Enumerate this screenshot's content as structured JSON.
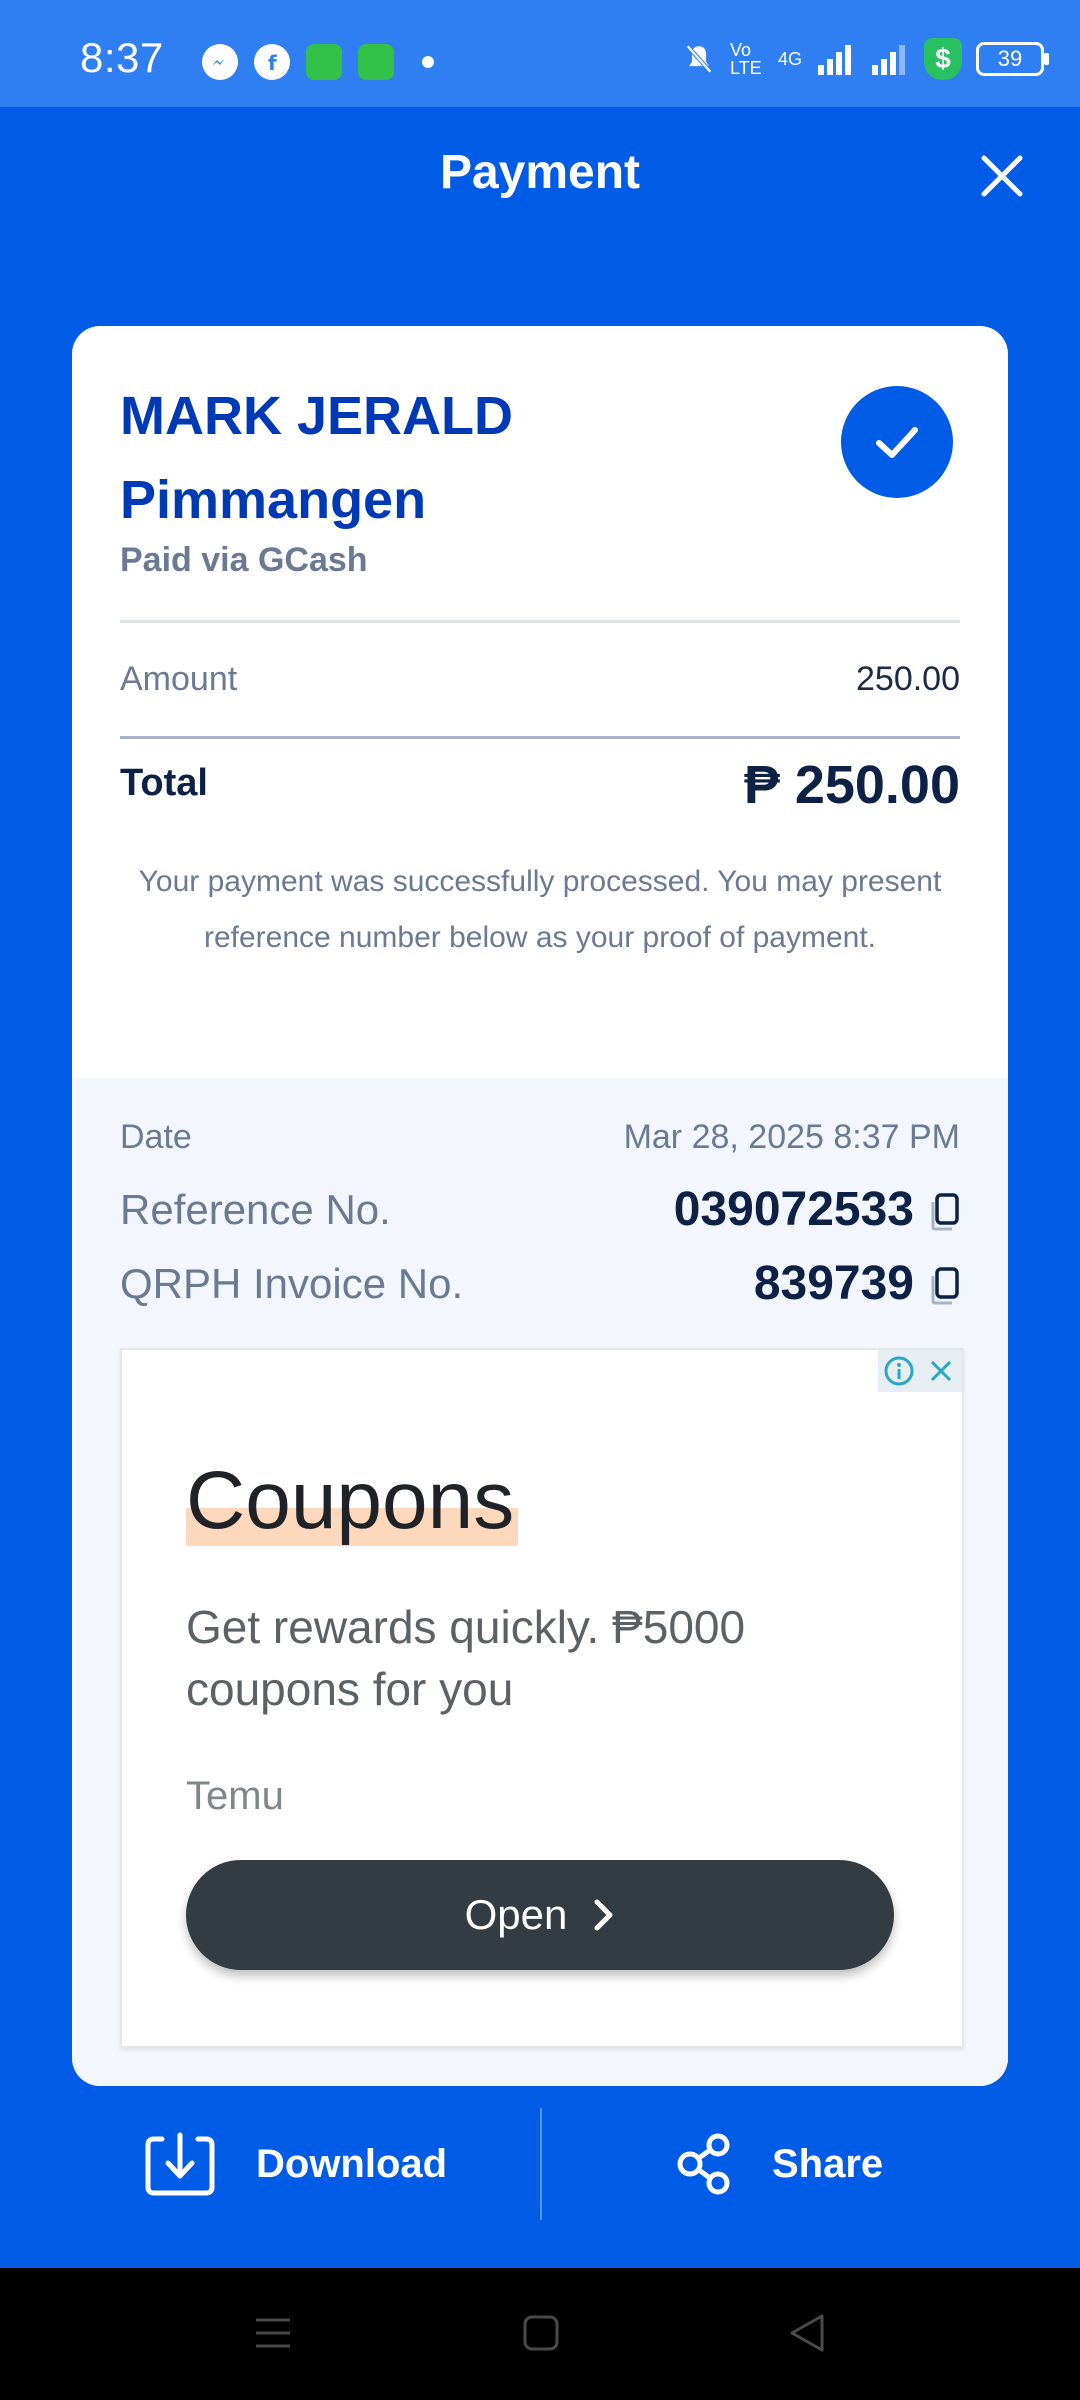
{
  "status_bar": {
    "time": "8:37",
    "battery": "39",
    "network": "4G",
    "volte": "Vo LTE"
  },
  "header": {
    "title": "Payment"
  },
  "receipt": {
    "name_line1": "MARK JERALD",
    "name_line2": "Pimmangen",
    "paid_via": "Paid via GCash",
    "amount_label": "Amount",
    "amount_value": "250.00",
    "total_label": "Total",
    "total_value": "₱ 250.00",
    "note": "Your payment was successfully processed. You may present reference number below as your proof of payment.",
    "date_label": "Date",
    "date_value": "Mar 28, 2025 8:37 PM",
    "reference_label": "Reference No.",
    "reference_value": "039072533",
    "invoice_label": "QRPH Invoice No.",
    "invoice_value": "839739"
  },
  "ad": {
    "title": "Coupons",
    "subtitle": "Get rewards quickly. ₱5000 coupons for you",
    "brand": "Temu",
    "button_label": "Open"
  },
  "actions": {
    "download_label": "Download",
    "share_label": "Share"
  },
  "colors": {
    "primary": "#005ce6",
    "name_blue": "#0039b5",
    "status_bar": "#2f7ef2"
  }
}
